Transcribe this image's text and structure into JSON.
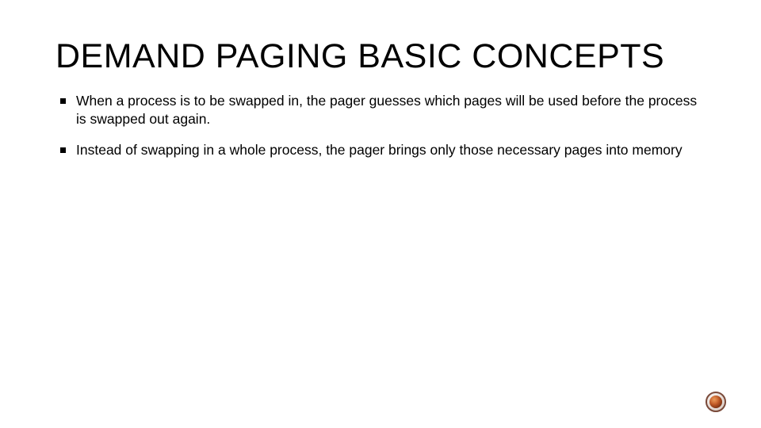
{
  "slide": {
    "title": "DEMAND PAGING BASIC CONCEPTS",
    "bullets": [
      "When a process is to be swapped in, the pager guesses which pages will be used before the process is swapped out again.",
      "Instead of swapping in a whole process, the pager brings only those necessary pages into memory"
    ]
  }
}
